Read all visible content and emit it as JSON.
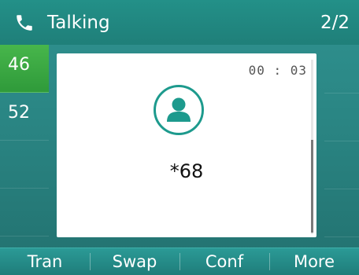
{
  "title_bar": {
    "status": "Talking",
    "page": "2/2",
    "icon": "phone-handset-icon"
  },
  "line_keys": [
    {
      "label": "46",
      "active": true
    },
    {
      "label": "52",
      "active": false
    }
  ],
  "call": {
    "duration": "00 : 03",
    "number": "*68",
    "avatar_icon": "contact-avatar-icon"
  },
  "softkeys": [
    {
      "label": "Tran"
    },
    {
      "label": "Swap"
    },
    {
      "label": "Conf"
    },
    {
      "label": "More"
    }
  ],
  "colors": {
    "accent": "#1d9a8d",
    "active_line": "#3aa83f"
  }
}
